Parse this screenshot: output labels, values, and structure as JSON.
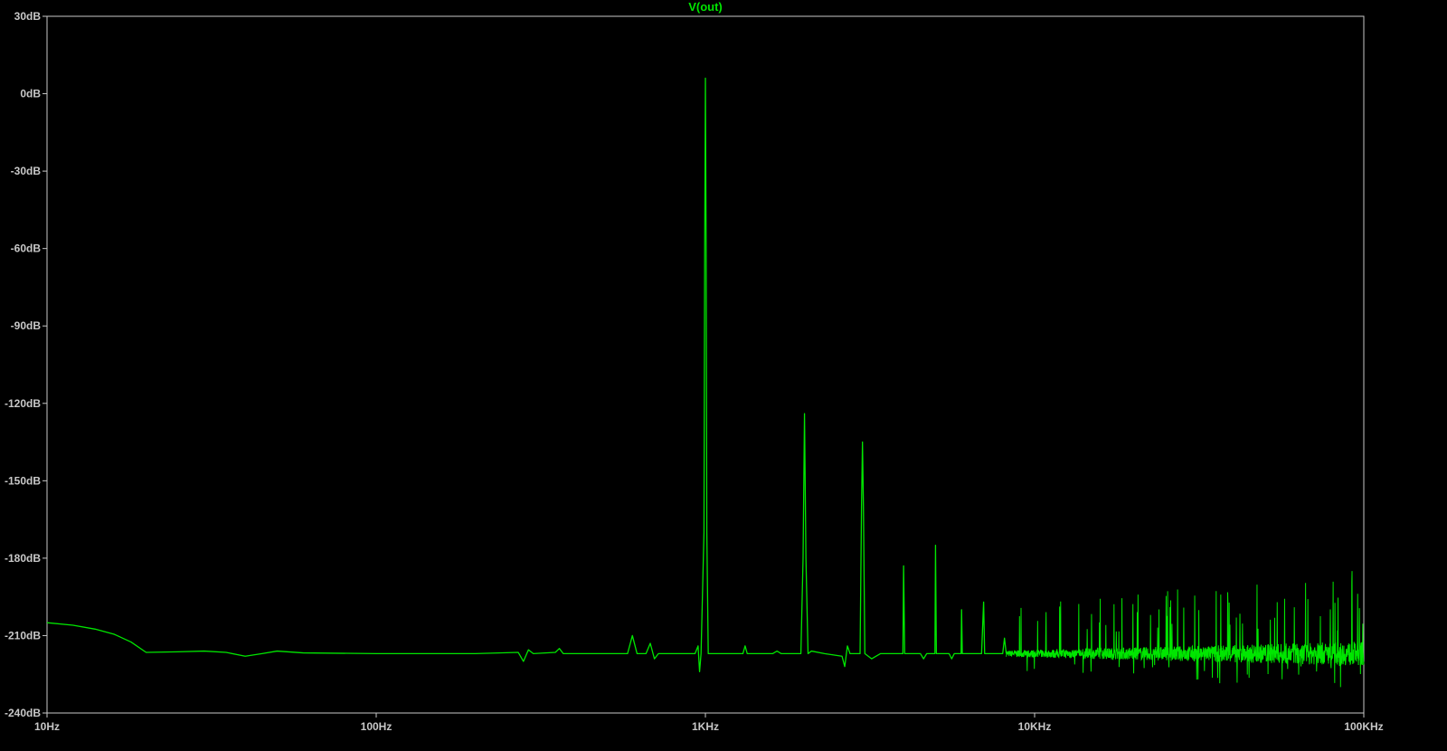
{
  "chart_data": {
    "type": "line",
    "title": "V(out)",
    "xscale": "log",
    "xlim": [
      10,
      100000
    ],
    "ylim": [
      -240,
      30
    ],
    "xticks": [
      {
        "value": 10,
        "label": "10Hz"
      },
      {
        "value": 100,
        "label": "100Hz"
      },
      {
        "value": 1000,
        "label": "1KHz"
      },
      {
        "value": 10000,
        "label": "10KHz"
      },
      {
        "value": 100000,
        "label": "100KHz"
      }
    ],
    "yticks": [
      {
        "value": 30,
        "label": "30dB"
      },
      {
        "value": 0,
        "label": "0dB"
      },
      {
        "value": -30,
        "label": "-30dB"
      },
      {
        "value": -60,
        "label": "-60dB"
      },
      {
        "value": -90,
        "label": "-90dB"
      },
      {
        "value": -120,
        "label": "-120dB"
      },
      {
        "value": -150,
        "label": "-150dB"
      },
      {
        "value": -180,
        "label": "-180dB"
      },
      {
        "value": -210,
        "label": "-210dB"
      },
      {
        "value": -240,
        "label": "-240dB"
      }
    ],
    "grid": false,
    "series": [
      {
        "name": "V(out)",
        "color": "#00e600",
        "baseline_db": -217,
        "points": [
          [
            10,
            -205
          ],
          [
            12,
            -206
          ],
          [
            14,
            -207.5
          ],
          [
            16,
            -209.5
          ],
          [
            18,
            -212.5
          ],
          [
            20,
            -216.5
          ],
          [
            25,
            -216.3
          ],
          [
            30,
            -216
          ],
          [
            35,
            -216.5
          ],
          [
            40,
            -218
          ],
          [
            45,
            -217
          ],
          [
            50,
            -216
          ],
          [
            60,
            -216.7
          ],
          [
            100,
            -217
          ],
          [
            200,
            -217
          ],
          [
            270,
            -216.5
          ],
          [
            280,
            -220
          ],
          [
            290,
            -215.5
          ],
          [
            300,
            -217
          ],
          [
            350,
            -216.5
          ],
          [
            360,
            -215
          ],
          [
            370,
            -217
          ],
          [
            580,
            -217
          ],
          [
            600,
            -210
          ],
          [
            620,
            -217
          ],
          [
            660,
            -217
          ],
          [
            680,
            -213
          ],
          [
            700,
            -219
          ],
          [
            720,
            -217
          ],
          [
            930,
            -217
          ],
          [
            950,
            -214
          ],
          [
            960,
            -224
          ],
          [
            970,
            -217
          ],
          [
            990,
            -170
          ],
          [
            995,
            -60
          ],
          [
            1000,
            6
          ],
          [
            1005,
            -60
          ],
          [
            1010,
            -170
          ],
          [
            1020,
            -217
          ],
          [
            1300,
            -217
          ],
          [
            1320,
            -214
          ],
          [
            1340,
            -217
          ],
          [
            1600,
            -217
          ],
          [
            1650,
            -216
          ],
          [
            1700,
            -217
          ],
          [
            1950,
            -217
          ],
          [
            1980,
            -180
          ],
          [
            2000,
            -124
          ],
          [
            2020,
            -180
          ],
          [
            2050,
            -217
          ],
          [
            2100,
            -216
          ],
          [
            2300,
            -217
          ],
          [
            2600,
            -218
          ],
          [
            2650,
            -222
          ],
          [
            2700,
            -214
          ],
          [
            2750,
            -217
          ],
          [
            2950,
            -217
          ],
          [
            2980,
            -160
          ],
          [
            3000,
            -135
          ],
          [
            3020,
            -160
          ],
          [
            3050,
            -217
          ],
          [
            3200,
            -219
          ],
          [
            3400,
            -217
          ],
          [
            3980,
            -217
          ],
          [
            4000,
            -183
          ],
          [
            4030,
            -217
          ],
          [
            4500,
            -217
          ],
          [
            4600,
            -219
          ],
          [
            4700,
            -217
          ],
          [
            4980,
            -217
          ],
          [
            5000,
            -175
          ],
          [
            5030,
            -217
          ],
          [
            5500,
            -217
          ],
          [
            5600,
            -219
          ],
          [
            5700,
            -217
          ],
          [
            5980,
            -217
          ],
          [
            6000,
            -200
          ],
          [
            6030,
            -217
          ],
          [
            6900,
            -217
          ],
          [
            7000,
            -197
          ],
          [
            7050,
            -217
          ],
          [
            8000,
            -217
          ],
          [
            8100,
            -211
          ],
          [
            8200,
            -217
          ]
        ]
      }
    ]
  }
}
